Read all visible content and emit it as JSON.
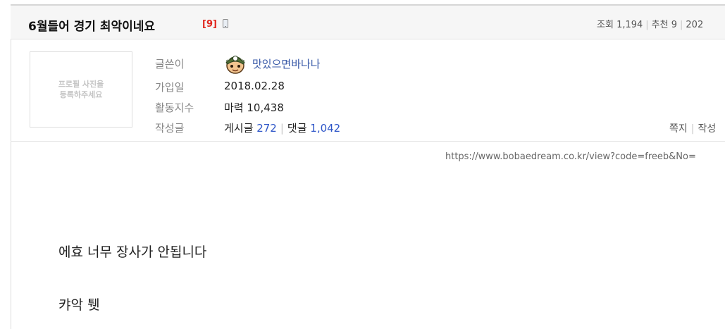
{
  "post": {
    "title": "6월들어 경기 최악이네요",
    "comment_count": "[9]",
    "stats": {
      "views_label": "조회",
      "views": "1,194",
      "recommend_label": "추천",
      "recommend": "9",
      "date_partial": "202"
    }
  },
  "author": {
    "profile_placeholder": "프로필 사진을\n등록하주세요",
    "labels": {
      "writer": "글쓴이",
      "joined": "가입일",
      "activity": "활동지수",
      "posts": "작성글"
    },
    "nickname": "맛있으면바나나",
    "joined": "2018.02.28",
    "activity_label": "마력",
    "activity_value": "10,438",
    "posts_label": "게시글",
    "posts_count": "272",
    "comments_label": "댓글",
    "comments_count": "1,042",
    "actions": {
      "message": "쪽지",
      "written_partial": "작성"
    }
  },
  "content": {
    "source_url": "https://www.bobaedream.co.kr/view?code=freeb&No=",
    "lines": [
      "에효 너무 장사가 안됩니다",
      "캬악 퉷"
    ]
  },
  "icons": {
    "mobile": "mobile-phone-icon",
    "avatar": "character-avatar-icon"
  },
  "colors": {
    "comment_count": "#e0261e",
    "link": "#2d55c8",
    "nickname": "#3a5aa8"
  }
}
